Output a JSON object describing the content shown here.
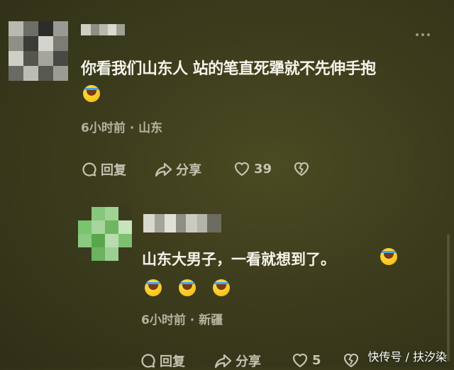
{
  "comments": [
    {
      "text": "你看我们山东人 站的笔直死犟就不先伸手抱",
      "time": "6小时前",
      "location": "山东",
      "reply_label": "回复",
      "share_label": "分享",
      "likes": "39"
    },
    {
      "text": "山东大男子，一看就想到了。",
      "time": "6小时前",
      "location": "新疆",
      "reply_label": "回复",
      "share_label": "分享",
      "likes": "5"
    }
  ],
  "meta_separator": "·",
  "watermark": "快传号 / 扶汐染",
  "icons": [
    "more-icon",
    "reply-icon",
    "share-icon",
    "like-icon",
    "dislike-icon",
    "laughing-emoji-icon"
  ],
  "colors": {
    "background": "#3c3c1d",
    "text": "#f4f4ea",
    "meta": "#b3b39e"
  }
}
